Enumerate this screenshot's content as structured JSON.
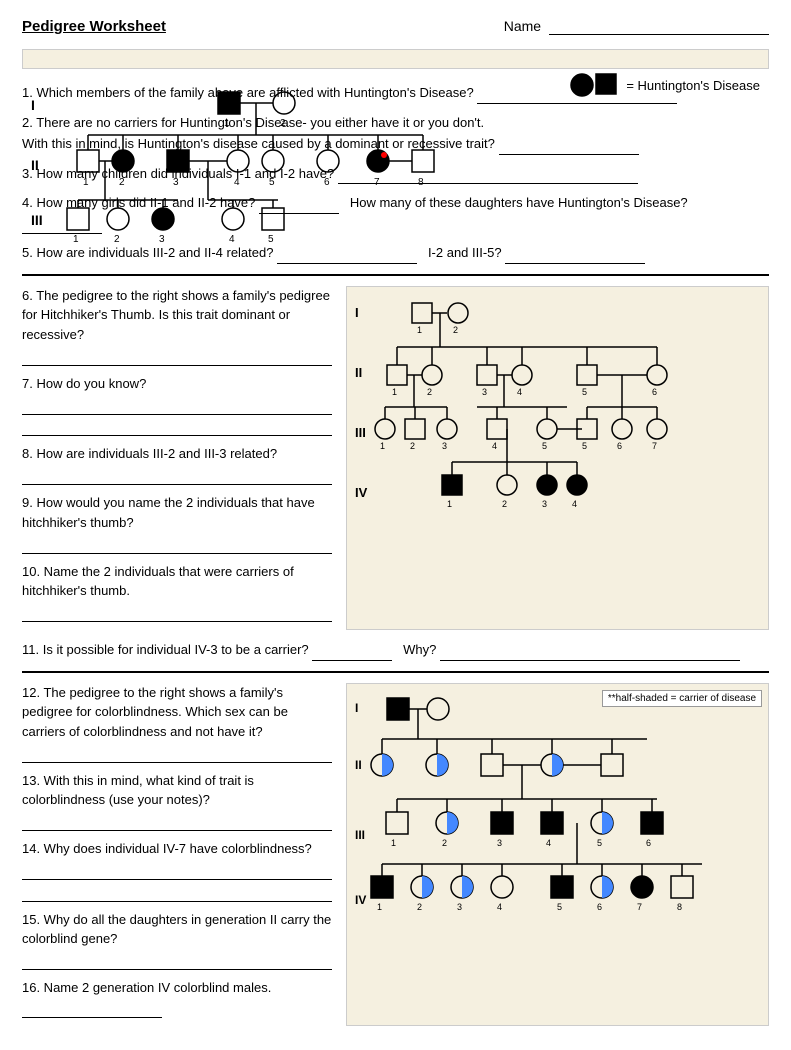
{
  "header": {
    "title": "Pedigree Worksheet",
    "name_label": "Name"
  },
  "legend": {
    "description": "= Huntington's Disease"
  },
  "questions": {
    "q1": "1. Which members of the family above are afflicted with Huntington's Disease?",
    "q2a": "2. There are no carriers for Huntington's Disease- you either have it or you don't.",
    "q2b": "     With this in mind, is Huntington's disease caused by a dominant or recessive trait?",
    "q3": "3. How many children did individuals I-1 and I-2 have?",
    "q4a": "4. How many girls did II-1 and II-2 have?",
    "q4b": "How many of these daughters have Huntington's Disease?",
    "q5a": "5. How are individuals III-2 and II-4 related?",
    "q5b": "I-2 and III-5?",
    "q6": "6. The pedigree to the right shows a family's pedigree for Hitchhiker's Thumb. Is this trait dominant or recessive?",
    "q7": "7. How do you know?",
    "q8": "8. How are individuals III-2 and III-3 related?",
    "q9": "9. How would you name the 2 individuals that have hitchhiker's thumb?",
    "q10": "10. Name the 2 individuals that were carriers of hitchhiker's thumb.",
    "q11": "11. Is it possible for individual IV-3 to be a carrier?",
    "q11b": "Why?",
    "q12": "12. The pedigree to the right shows a family's pedigree for colorblindness.  Which sex can be carriers of colorblindness and not have it?",
    "q13": "13. With this in mind, what kind of trait is colorblindness (use your notes)?",
    "q14": "14. Why does individual IV-7 have colorblindness?",
    "q15": "15. Why do all the daughters in generation II carry the colorblind gene?",
    "q16": "16. Name 2 generation IV colorblind males.",
    "carrier_note": "**half-shaded = carrier of disease"
  },
  "gen_labels": {
    "I": "I",
    "II": "II",
    "III": "III",
    "IV": "IV"
  }
}
